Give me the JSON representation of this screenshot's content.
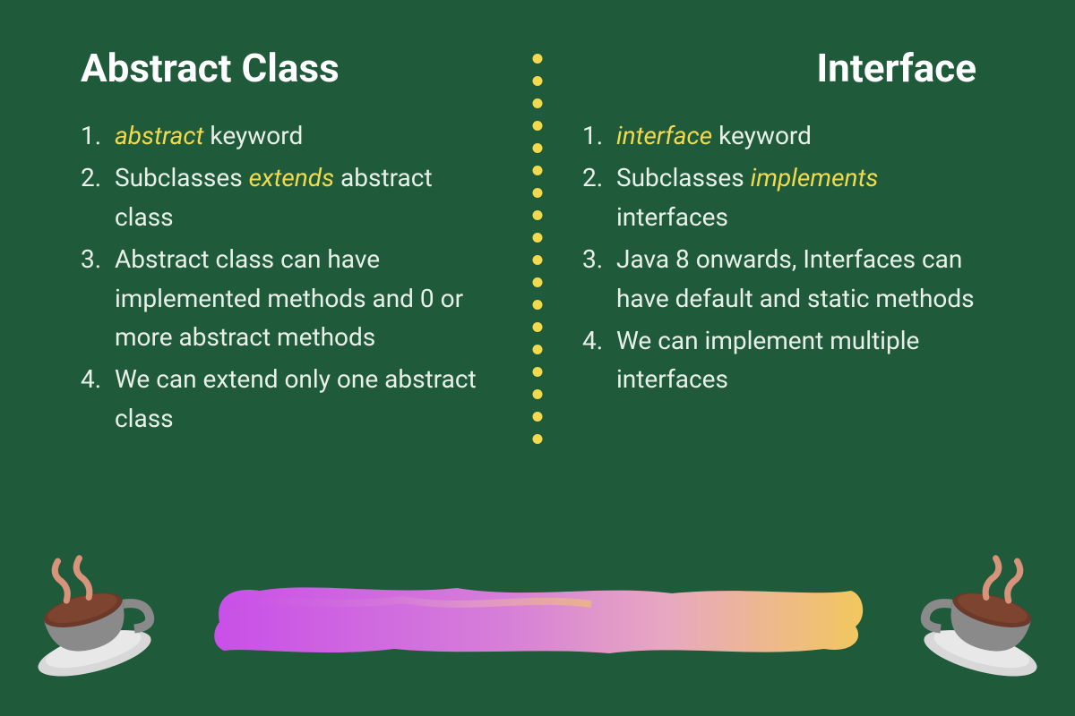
{
  "left": {
    "title": "Abstract Class",
    "items": [
      {
        "pre": "",
        "kw": "abstract",
        "post": " keyword"
      },
      {
        "pre": "Subclasses ",
        "kw": "extends",
        "post": " abstract class"
      },
      {
        "pre": "Abstract class can have implemented methods and 0 or more abstract methods",
        "kw": "",
        "post": ""
      },
      {
        "pre": "We can extend only one abstract class",
        "kw": "",
        "post": ""
      }
    ]
  },
  "right": {
    "title": "Interface",
    "items": [
      {
        "pre": "",
        "kw": "interface",
        "post": " keyword"
      },
      {
        "pre": "Subclasses ",
        "kw": "implements",
        "post": " interfaces"
      },
      {
        "pre": "Java 8 onwards, Interfaces can have default and static methods",
        "kw": "",
        "post": ""
      },
      {
        "pre": "We can implement multiple interfaces",
        "kw": "",
        "post": ""
      }
    ]
  },
  "dots": 18
}
